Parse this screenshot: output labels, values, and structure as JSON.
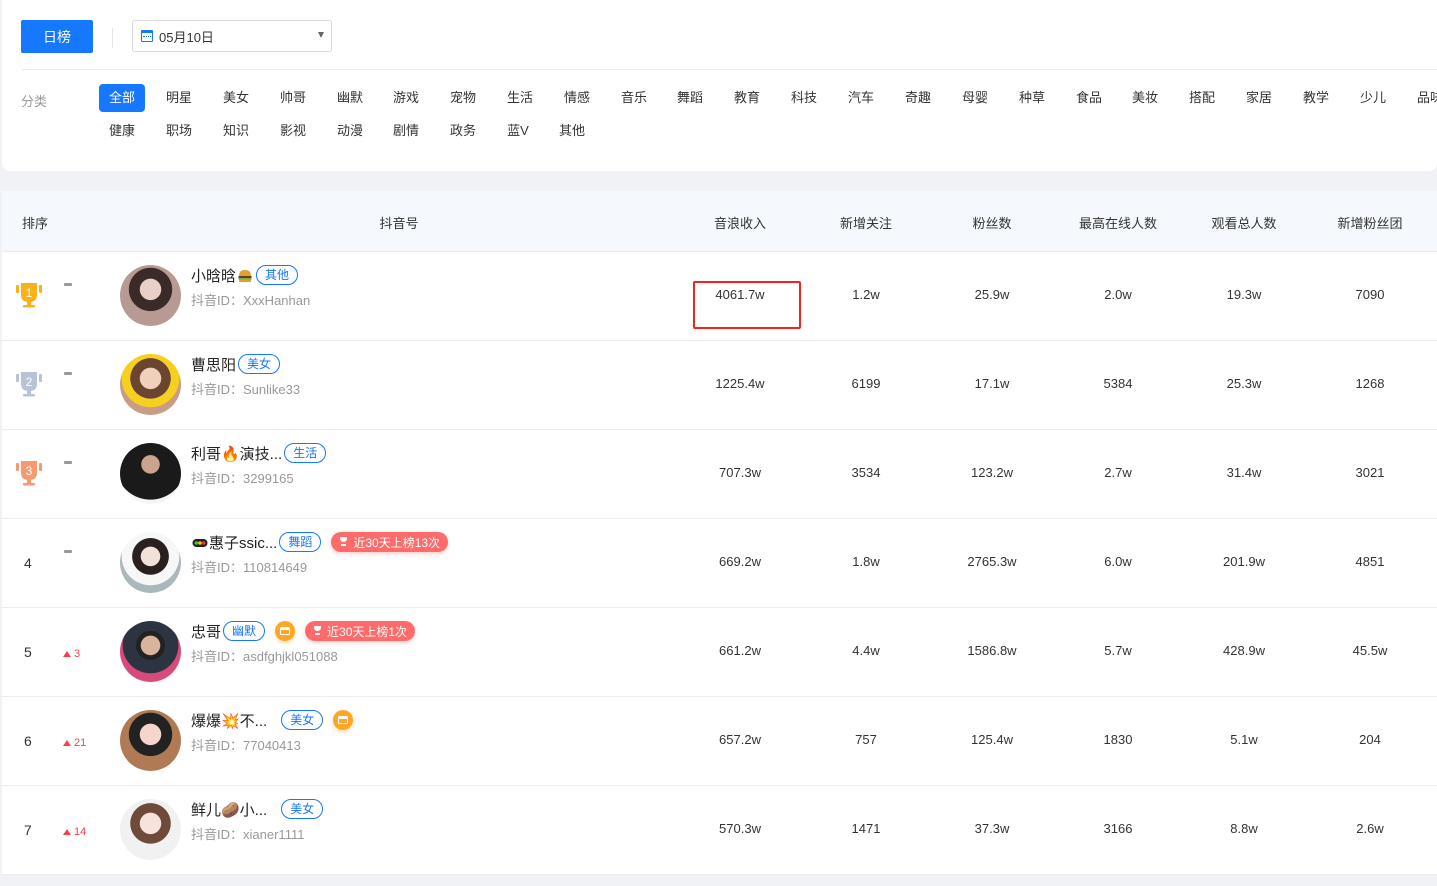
{
  "toolbar": {
    "rank_type_label": "日榜",
    "date_value": "05月10日"
  },
  "categories": {
    "label": "分类",
    "active": "全部",
    "row1": [
      "全部",
      "明星",
      "美女",
      "帅哥",
      "幽默",
      "游戏",
      "宠物",
      "生活",
      "情感",
      "音乐",
      "舞蹈",
      "教育",
      "科技",
      "汽车",
      "奇趣",
      "母婴",
      "种草",
      "食品",
      "美妆",
      "搭配",
      "家居",
      "教学",
      "少儿",
      "品味"
    ],
    "row2": [
      "健康",
      "职场",
      "知识",
      "影视",
      "动漫",
      "剧情",
      "政务",
      "蓝V",
      "其他"
    ]
  },
  "table": {
    "headers": {
      "rank": "排序",
      "account": "抖音号",
      "income": "音浪收入",
      "new_follows": "新增关注",
      "fans": "粉丝数",
      "peak_online": "最高在线人数",
      "total_viewers": "观看总人数",
      "new_fan_club": "新增粉丝团"
    },
    "id_prefix": "抖音ID：",
    "rows": [
      {
        "rank": "1",
        "trophy": "gold",
        "change": "-",
        "nickname": "小晗晗",
        "emoji": "hamburger",
        "tag": "其他",
        "shop": false,
        "hot": "",
        "douyin_id": "XxxHanhan",
        "income": "4061.7w",
        "new_follows": "1.2w",
        "fans": "25.9w",
        "peak_online": "2.0w",
        "total_viewers": "19.3w",
        "new_fan_club": "7090"
      },
      {
        "rank": "2",
        "trophy": "silver",
        "change": "-",
        "nickname": "曹思阳",
        "emoji": "",
        "tag": "美女",
        "shop": false,
        "hot": "",
        "douyin_id": "Sunlike33",
        "income": "1225.4w",
        "new_follows": "6199",
        "fans": "17.1w",
        "peak_online": "5384",
        "total_viewers": "25.3w",
        "new_fan_club": "1268"
      },
      {
        "rank": "3",
        "trophy": "bronze",
        "change": "-",
        "nickname": "利哥🔥演技...",
        "emoji": "",
        "tag": "生活",
        "shop": false,
        "hot": "",
        "douyin_id": "3299165",
        "income": "707.3w",
        "new_follows": "3534",
        "fans": "123.2w",
        "peak_online": "2.7w",
        "total_viewers": "31.4w",
        "new_fan_club": "3021"
      },
      {
        "rank": "4",
        "trophy": "",
        "change": "-",
        "nickname": "惠子ssic...",
        "emoji": "traffic-light",
        "tag": "舞蹈",
        "shop": false,
        "hot": "近30天上榜13次",
        "douyin_id": "110814649",
        "income": "669.2w",
        "new_follows": "1.8w",
        "fans": "2765.3w",
        "peak_online": "6.0w",
        "total_viewers": "201.9w",
        "new_fan_club": "4851"
      },
      {
        "rank": "5",
        "trophy": "",
        "change": "3",
        "nickname": "忠哥",
        "emoji": "",
        "tag": "幽默",
        "shop": true,
        "hot": "近30天上榜1次",
        "douyin_id": "asdfghjkl051088",
        "income": "661.2w",
        "new_follows": "4.4w",
        "fans": "1586.8w",
        "peak_online": "5.7w",
        "total_viewers": "428.9w",
        "new_fan_club": "45.5w"
      },
      {
        "rank": "6",
        "trophy": "",
        "change": "21",
        "nickname": "爆爆💥不...",
        "emoji": "",
        "tag": "美女",
        "shop": true,
        "hot": "",
        "douyin_id": "77040413",
        "income": "657.2w",
        "new_follows": "757",
        "fans": "125.4w",
        "peak_online": "1830",
        "total_viewers": "5.1w",
        "new_fan_club": "204"
      },
      {
        "rank": "7",
        "trophy": "",
        "change": "14",
        "nickname": "鲜儿🥔小...",
        "emoji": "",
        "tag": "美女",
        "shop": false,
        "hot": "",
        "douyin_id": "xianer1111",
        "income": "570.3w",
        "new_follows": "1471",
        "fans": "37.3w",
        "peak_online": "3166",
        "total_viewers": "8.8w",
        "new_fan_club": "2.6w"
      }
    ]
  },
  "colors": {
    "primary": "#1677ff",
    "gold": "#fbb21a",
    "silver": "#b8c4d6",
    "bronze": "#f79a72",
    "up": "#f5424b",
    "hot_badge": "#ff6a6a",
    "shop": "#ffa629",
    "highlight": "#f0261e"
  }
}
